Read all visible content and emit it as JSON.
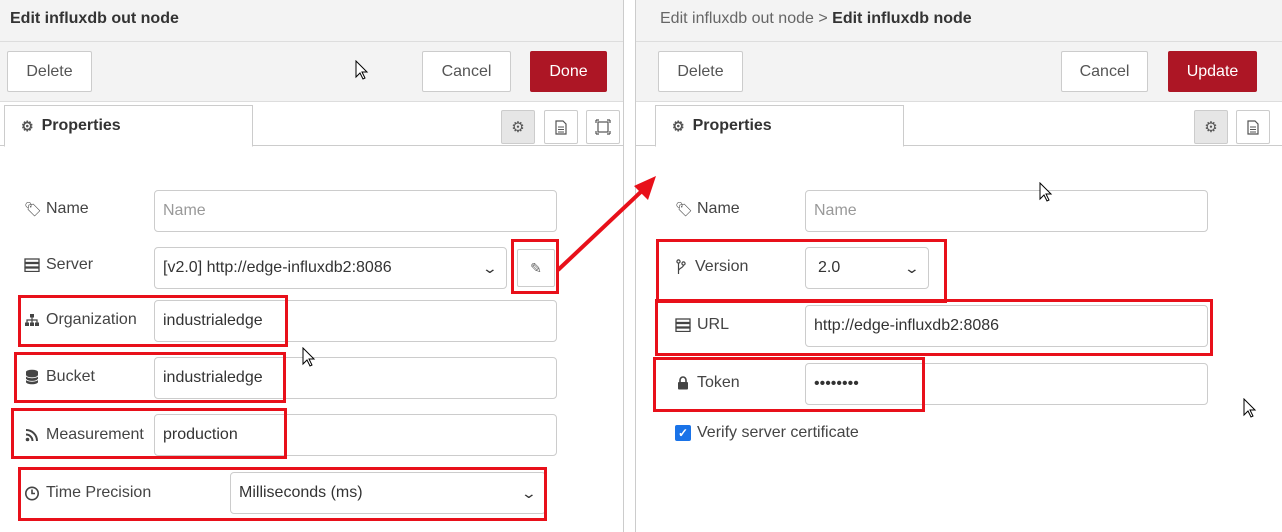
{
  "left": {
    "title": "Edit influxdb out node",
    "delete_label": "Delete",
    "cancel_label": "Cancel",
    "done_label": "Done",
    "tab_label": "Properties",
    "fields": {
      "name_label": "Name",
      "name_placeholder": "Name",
      "server_label": "Server",
      "server_value": "[v2.0] http://edge-influxdb2:8086",
      "organization_label": "Organization",
      "organization_value": "industrialedge",
      "bucket_label": "Bucket",
      "bucket_value": "industrialedge",
      "measurement_label": "Measurement",
      "measurement_value": "production",
      "time_precision_label": "Time Precision",
      "time_precision_value": "Milliseconds (ms)"
    }
  },
  "right": {
    "title_parent": "Edit influxdb out node",
    "title_separator": ">",
    "title_current": "Edit influxdb node",
    "delete_label": "Delete",
    "cancel_label": "Cancel",
    "update_label": "Update",
    "tab_label": "Properties",
    "fields": {
      "name_label": "Name",
      "name_placeholder": "Name",
      "version_label": "Version",
      "version_value": "2.0",
      "url_label": "URL",
      "url_value": "http://edge-influxdb2:8086",
      "token_label": "Token",
      "token_value": "••••••••",
      "verify_label": "Verify server certificate"
    }
  },
  "colors": {
    "primary_button": "#ad1625",
    "highlight": "#e8101a",
    "checkbox": "#1a73e8"
  },
  "icons": [
    "tag-icon",
    "server-icon",
    "sitemap-icon",
    "database-icon",
    "rss-icon",
    "clock-icon",
    "branch-icon",
    "lock-icon",
    "gear-icon",
    "document-icon",
    "expand-icon",
    "pencil-icon",
    "chevron-down-icon",
    "checkmark-icon"
  ]
}
